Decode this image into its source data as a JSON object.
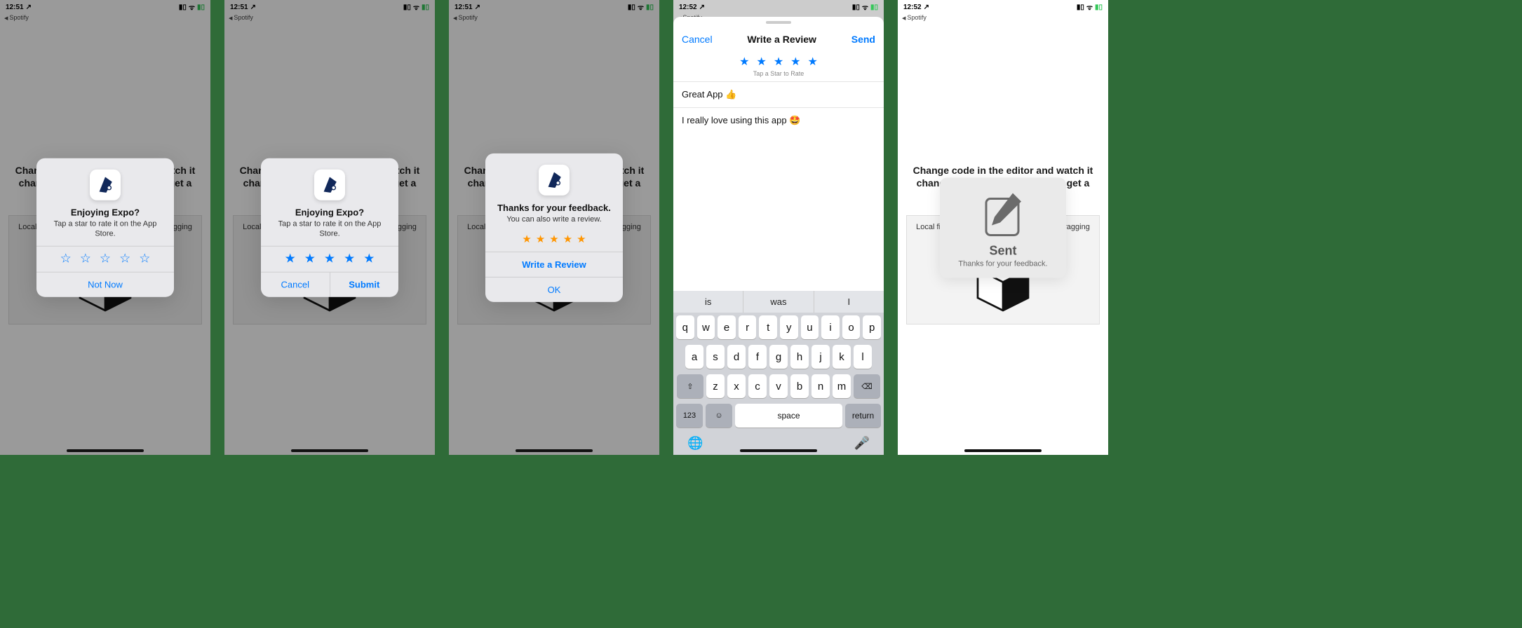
{
  "status": {
    "time1": "12:51",
    "time2": "12:52",
    "back": "Spotify",
    "loc": "↗"
  },
  "bg": {
    "headline": "Change code in the editor and watch it change on your device! Save to get a shareable url.",
    "box": "Local files and assets can be imported by dragging and dropping them into the editor"
  },
  "alert1": {
    "title": "Enjoying Expo?",
    "subtitle": "Tap a star to rate it on the App Store.",
    "notnow": "Not Now"
  },
  "alert2": {
    "title": "Enjoying Expo?",
    "subtitle": "Tap a star to rate it on the App Store.",
    "cancel": "Cancel",
    "submit": "Submit"
  },
  "alert3": {
    "title": "Thanks for your feedback.",
    "subtitle": "You can also write a review.",
    "write": "Write a Review",
    "ok": "OK"
  },
  "sheet": {
    "cancel": "Cancel",
    "title": "Write a Review",
    "send": "Send",
    "hint": "Tap a Star to Rate",
    "review_title": "Great App 👍",
    "review_body": "I really love using this app 🤩"
  },
  "predict": {
    "a": "is",
    "b": "was",
    "c": "I"
  },
  "kb": {
    "row1": [
      "q",
      "w",
      "e",
      "r",
      "t",
      "y",
      "u",
      "i",
      "o",
      "p"
    ],
    "row2": [
      "a",
      "s",
      "d",
      "f",
      "g",
      "h",
      "j",
      "k",
      "l"
    ],
    "row3": [
      "z",
      "x",
      "c",
      "v",
      "b",
      "n",
      "m"
    ],
    "num": "123",
    "space": "space",
    "ret": "return"
  },
  "toast": {
    "title": "Sent",
    "subtitle": "Thanks for your feedback."
  }
}
